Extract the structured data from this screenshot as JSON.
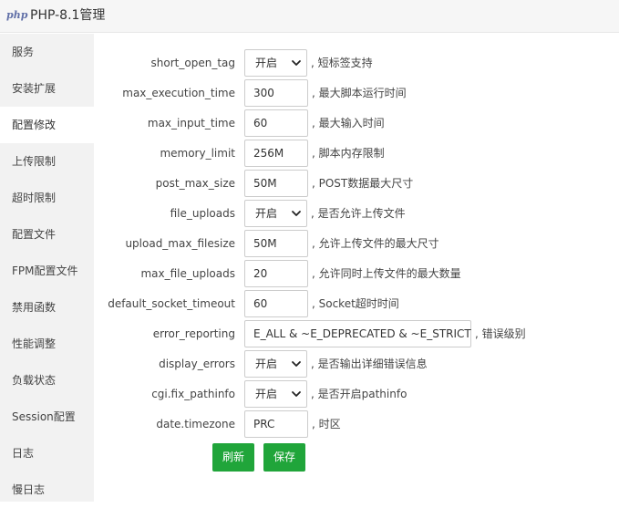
{
  "app": {
    "logo_text": "php",
    "title": "PHP-8.1管理"
  },
  "sidebar": {
    "items": [
      {
        "label": "服务"
      },
      {
        "label": "安装扩展"
      },
      {
        "label": "配置修改",
        "active": true
      },
      {
        "label": "上传限制"
      },
      {
        "label": "超时限制"
      },
      {
        "label": "配置文件"
      },
      {
        "label": "FPM配置文件"
      },
      {
        "label": "禁用函数"
      },
      {
        "label": "性能调整"
      },
      {
        "label": "负载状态"
      },
      {
        "label": "Session配置"
      },
      {
        "label": "日志"
      },
      {
        "label": "慢日志"
      }
    ]
  },
  "settings": [
    {
      "name": "short_open_tag",
      "type": "select",
      "value": "开启",
      "note": ", 短标签支持"
    },
    {
      "name": "max_execution_time",
      "type": "input",
      "value": "300",
      "note": ", 最大脚本运行时间"
    },
    {
      "name": "max_input_time",
      "type": "input",
      "value": "60",
      "note": ", 最大输入时间"
    },
    {
      "name": "memory_limit",
      "type": "input",
      "value": "256M",
      "note": ", 脚本内存限制"
    },
    {
      "name": "post_max_size",
      "type": "input",
      "value": "50M",
      "note": ", POST数据最大尺寸"
    },
    {
      "name": "file_uploads",
      "type": "select",
      "value": "开启",
      "note": ", 是否允许上传文件"
    },
    {
      "name": "upload_max_filesize",
      "type": "input",
      "value": "50M",
      "note": ", 允许上传文件的最大尺寸"
    },
    {
      "name": "max_file_uploads",
      "type": "input",
      "value": "20",
      "note": ", 允许同时上传文件的最大数量"
    },
    {
      "name": "default_socket_timeout",
      "type": "input",
      "value": "60",
      "note": ", Socket超时时间"
    },
    {
      "name": "error_reporting",
      "type": "wide",
      "value": "E_ALL & ~E_DEPRECATED & ~E_STRICT",
      "note": ", 错误级别"
    },
    {
      "name": "display_errors",
      "type": "select",
      "value": "开启",
      "note": ", 是否输出详细错误信息"
    },
    {
      "name": "cgi.fix_pathinfo",
      "type": "select",
      "value": "开启",
      "note": ", 是否开启pathinfo"
    },
    {
      "name": "date.timezone",
      "type": "input",
      "value": "PRC",
      "note": ", 时区"
    }
  ],
  "actions": {
    "refresh_label": "刷新",
    "save_label": "保存"
  },
  "colors": {
    "accent": "#20a53a",
    "sidebar_bg": "#f2f2f2",
    "titlebar_bg": "#f6f6f6"
  }
}
